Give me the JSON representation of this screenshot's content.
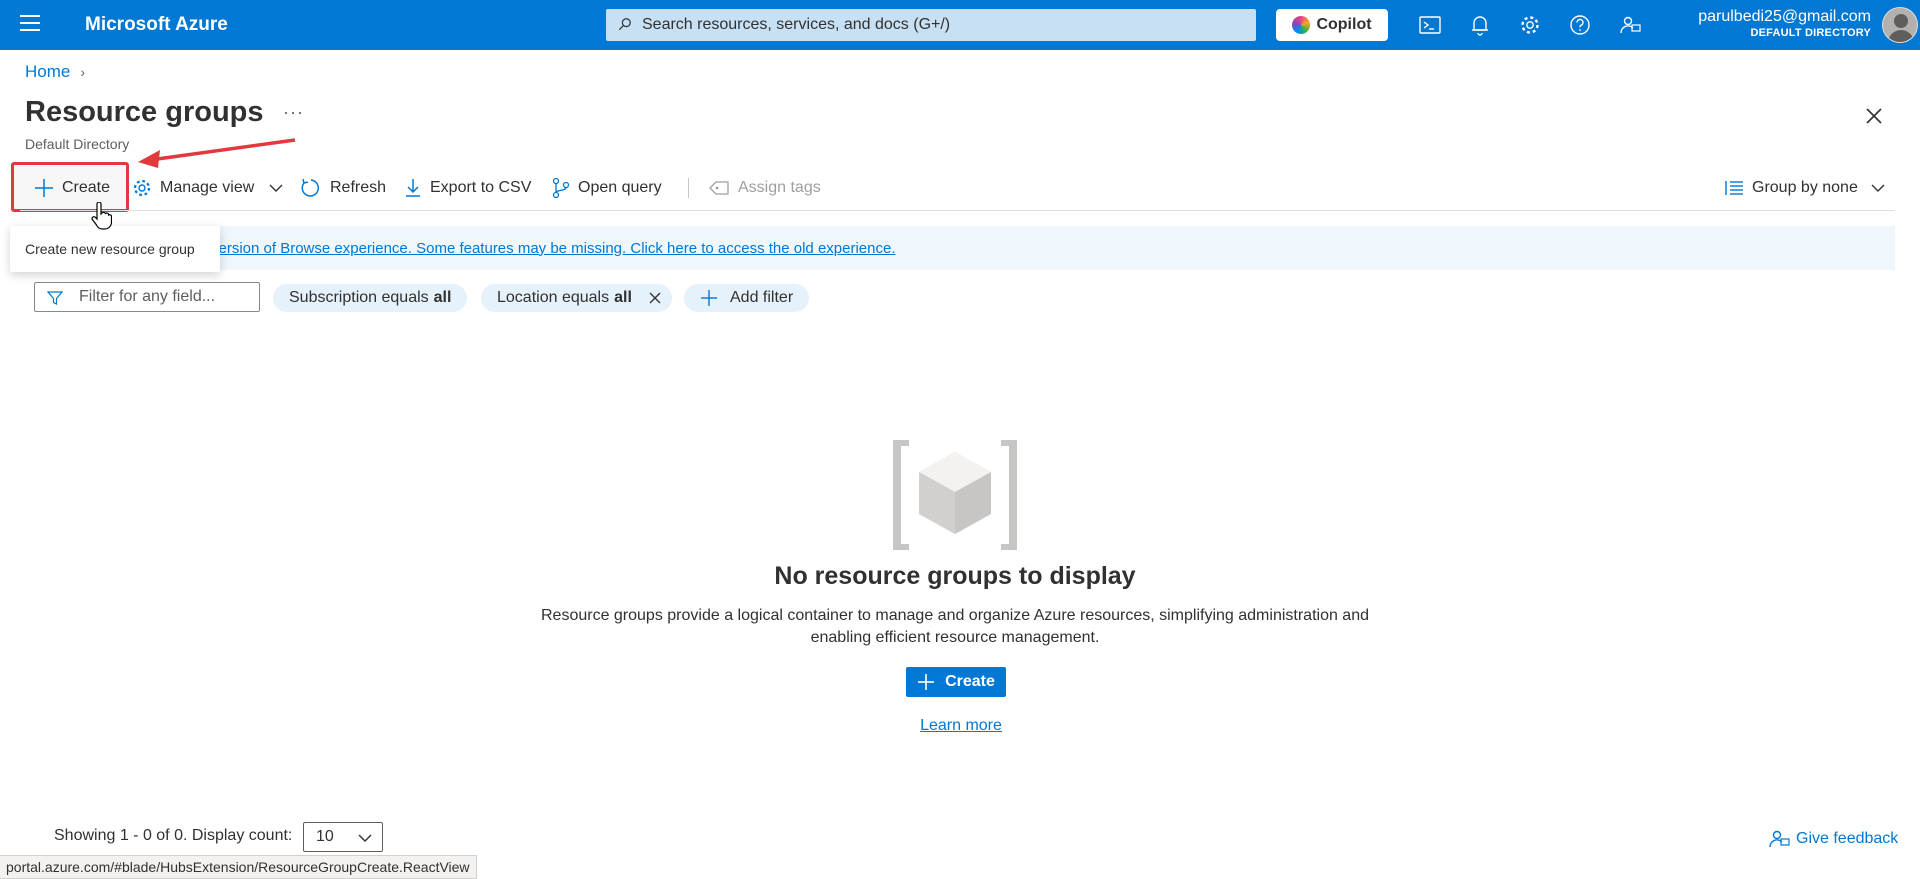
{
  "topbar": {
    "brand": "Microsoft Azure",
    "search_placeholder": "Search resources, services, and docs (G+/)",
    "copilot_label": "Copilot",
    "account_email": "parulbedi25@gmail.com",
    "account_directory": "DEFAULT DIRECTORY",
    "icons": [
      "cloud-shell-icon",
      "bell-icon",
      "gear-icon",
      "help-icon",
      "feedback-icon"
    ]
  },
  "breadcrumb": {
    "home": "Home"
  },
  "page": {
    "title": "Resource groups",
    "more": "···",
    "subtitle": "Default Directory"
  },
  "toolbar": {
    "create": "Create",
    "manage_view": "Manage view",
    "refresh": "Refresh",
    "export_csv": "Export to CSV",
    "open_query": "Open query",
    "assign_tags": "Assign tags",
    "group_by": "Group by none"
  },
  "tooltip": {
    "text": "Create new resource group"
  },
  "banner": {
    "link_text": "w version of Browse experience. Some features may be missing. Click here to access the old experience."
  },
  "filters": {
    "placeholder": "Filter for any field...",
    "subscription_label": "Subscription equals",
    "subscription_value": "all",
    "location_label": "Location equals",
    "location_value": "all",
    "add_filter": "Add filter"
  },
  "empty_state": {
    "title": "No resource groups to display",
    "description": "Resource groups provide a logical container to manage and organize Azure resources, simplifying administration and enabling efficient resource management.",
    "create": "Create",
    "learn_more": "Learn more"
  },
  "footer": {
    "showing": "Showing 1 - 0 of 0. Display count:",
    "display_count": "10",
    "feedback": "Give feedback",
    "status_url": "portal.azure.com/#blade/HubsExtension/ResourceGroupCreate.ReactView"
  },
  "colors": {
    "accent": "#0078d4",
    "highlight": "#e0393e",
    "banner_bg": "#eff6fc",
    "pill_bg": "#e5f1fb"
  }
}
